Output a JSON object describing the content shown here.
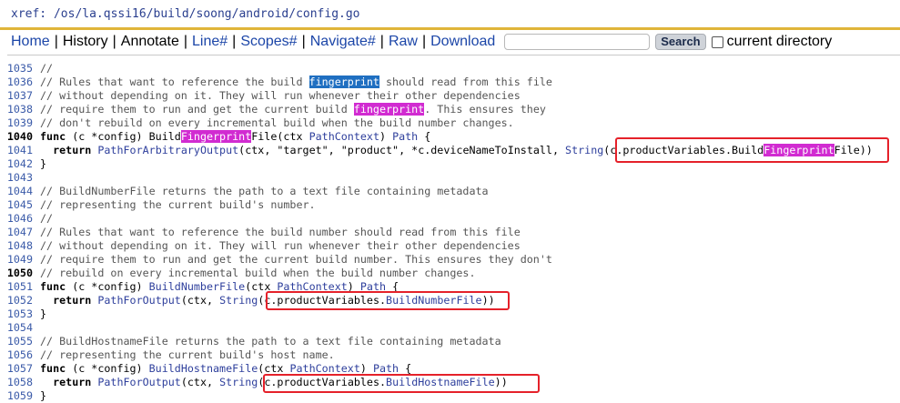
{
  "header": {
    "xref": "xref: /os/la.qssi16/build/soong/android/config.go"
  },
  "nav": {
    "home": "Home",
    "history": "History",
    "annotate": "Annotate",
    "line": "Line#",
    "scopes": "Scopes#",
    "navigate": "Navigate#",
    "raw": "Raw",
    "download": "Download",
    "search_button": "Search",
    "current_directory": "current directory",
    "search_value": ""
  },
  "code": {
    "lines": [
      {
        "n": "1035",
        "t": "//"
      },
      {
        "n": "1036",
        "t": "// Rules that want to reference the build fingerprint should read from this file"
      },
      {
        "n": "1037",
        "t": "// without depending on it. They will run whenever their other dependencies"
      },
      {
        "n": "1038",
        "t": "// require them to run and get the current build fingerprint. This ensures they"
      },
      {
        "n": "1039",
        "t": "// don't rebuild on every incremental build when the build number changes."
      },
      {
        "n": "1040",
        "t": "func (c *config) BuildFingerprintFile(ctx PathContext) Path {"
      },
      {
        "n": "1041",
        "t": "  return PathForArbitraryOutput(ctx, \"target\", \"product\", *c.deviceNameToInstall, String(c.productVariables.BuildFingerprintFile))"
      },
      {
        "n": "1042",
        "t": "}"
      },
      {
        "n": "1043",
        "t": ""
      },
      {
        "n": "1044",
        "t": "// BuildNumberFile returns the path to a text file containing metadata"
      },
      {
        "n": "1045",
        "t": "// representing the current build's number."
      },
      {
        "n": "1046",
        "t": "//"
      },
      {
        "n": "1047",
        "t": "// Rules that want to reference the build number should read from this file"
      },
      {
        "n": "1048",
        "t": "// without depending on it. They will run whenever their other dependencies"
      },
      {
        "n": "1049",
        "t": "// require them to run and get the current build number. This ensures they don't"
      },
      {
        "n": "1050",
        "t": "// rebuild on every incremental build when the build number changes."
      },
      {
        "n": "1051",
        "t": "func (c *config) BuildNumberFile(ctx PathContext) Path {"
      },
      {
        "n": "1052",
        "t": "  return PathForOutput(ctx, String(c.productVariables.BuildNumberFile))"
      },
      {
        "n": "1053",
        "t": "}"
      },
      {
        "n": "1054",
        "t": ""
      },
      {
        "n": "1055",
        "t": "// BuildHostnameFile returns the path to a text file containing metadata"
      },
      {
        "n": "1056",
        "t": "// representing the current build's host name."
      },
      {
        "n": "1057",
        "t": "func (c *config) BuildHostnameFile(ctx PathContext) Path {"
      },
      {
        "n": "1058",
        "t": "  return PathForOutput(ctx, String(c.productVariables.BuildHostnameFile))"
      },
      {
        "n": "1059",
        "t": "}"
      }
    ],
    "bold_line_numbers": [
      "1040",
      "1050"
    ]
  },
  "colors": {
    "highlight_search_term": "#1f6fc1",
    "highlight_match": "#d12bd1",
    "annotation_box": "#e5212a",
    "nav_link": "#1c46a8"
  }
}
